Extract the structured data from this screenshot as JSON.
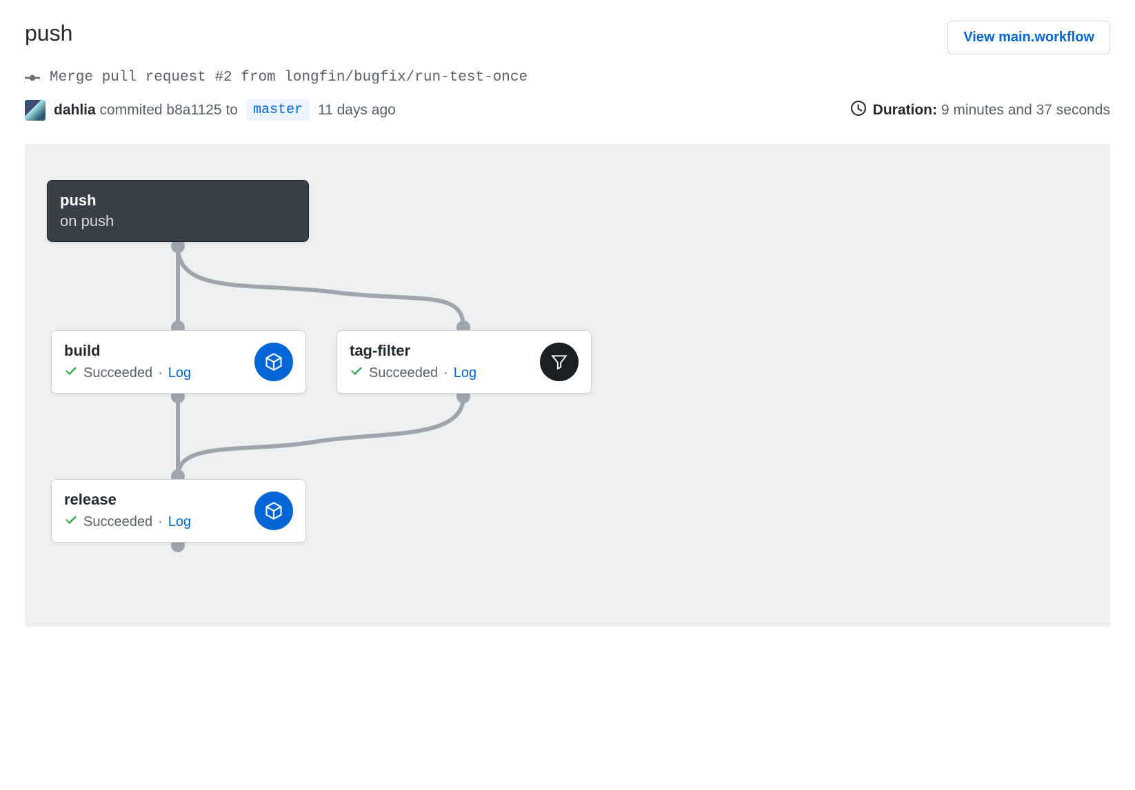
{
  "header": {
    "title": "push",
    "view_button": "View main.workflow"
  },
  "commit": {
    "message": "Merge pull request #2 from longfin/bugfix/run-test-once"
  },
  "meta": {
    "author": "dahlia",
    "commited_word": "commited",
    "sha": "b8a1125",
    "to_word": "to",
    "branch": "master",
    "when": "11 days ago",
    "duration_label": "Duration:",
    "duration_value": "9 minutes and 37 seconds"
  },
  "workflow": {
    "trigger": {
      "name": "push",
      "subtitle": "on push"
    },
    "actions": {
      "build": {
        "name": "build",
        "status": "Succeeded",
        "log": "Log",
        "icon": "cube"
      },
      "tagfilter": {
        "name": "tag-filter",
        "status": "Succeeded",
        "log": "Log",
        "icon": "filter"
      },
      "release": {
        "name": "release",
        "status": "Succeeded",
        "log": "Log",
        "icon": "cube"
      }
    }
  }
}
